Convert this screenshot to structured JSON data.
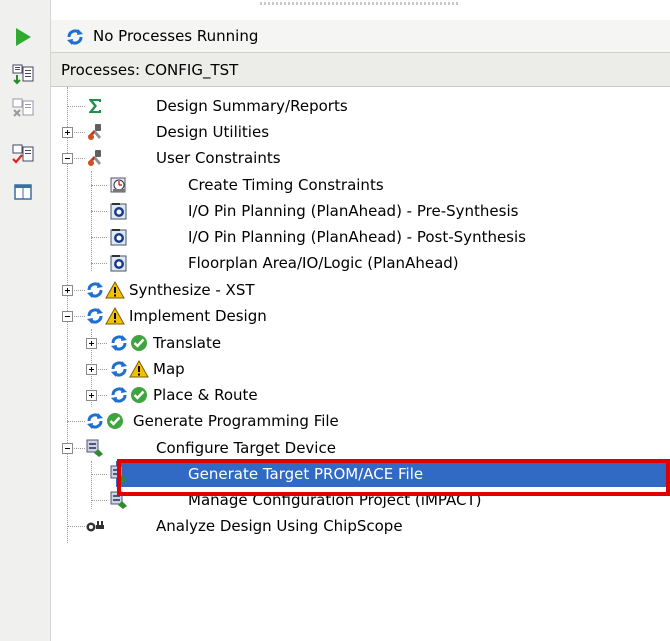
{
  "status": {
    "text": "No Processes Running",
    "icon": "refresh-icon"
  },
  "processes_header": "Processes: CONFIG_TST",
  "toolbar": [
    {
      "name": "run-icon"
    },
    {
      "name": "add-sources-icon"
    },
    {
      "name": "remove-sources-icon"
    },
    {
      "name": "check-sources-icon"
    },
    {
      "name": "window-icon"
    }
  ],
  "tree": [
    {
      "label": "Design Summary/Reports",
      "status": "none",
      "icon": "sigma-icon"
    },
    {
      "label": "Design Utilities",
      "status": "none",
      "icon": "tools-icon",
      "expanded": false
    },
    {
      "label": "User Constraints",
      "status": "none",
      "icon": "tools-icon",
      "expanded": true
    },
    {
      "label": "Create Timing Constraints",
      "status": "none",
      "icon": "clock-icon"
    },
    {
      "label": "I/O Pin Planning (PlanAhead) - Pre-Synthesis",
      "status": "none",
      "icon": "planahead-icon"
    },
    {
      "label": "I/O Pin Planning (PlanAhead) - Post-Synthesis",
      "status": "none",
      "icon": "planahead-icon"
    },
    {
      "label": "Floorplan Area/IO/Logic (PlanAhead)",
      "status": "none",
      "icon": "planahead-icon"
    },
    {
      "label": "Synthesize - XST",
      "status": "warning",
      "icon": "process-icon",
      "expanded": false
    },
    {
      "label": "Implement Design",
      "status": "warning",
      "icon": "process-icon",
      "expanded": true
    },
    {
      "label": "Translate",
      "status": "ok",
      "icon": "process-icon",
      "expanded": false
    },
    {
      "label": "Map",
      "status": "warning",
      "icon": "process-icon",
      "expanded": false
    },
    {
      "label": "Place & Route",
      "status": "ok",
      "icon": "process-icon",
      "expanded": false
    },
    {
      "label": "Generate Programming File",
      "status": "ok",
      "icon": "process-icon"
    },
    {
      "label": "Configure Target Device",
      "status": "none",
      "icon": "device-icon",
      "expanded": true
    },
    {
      "label": "Generate Target PROM/ACE File",
      "status": "none",
      "icon": "device-icon",
      "selected": true
    },
    {
      "label": "Manage Configuration Project (iMPACT)",
      "status": "none",
      "icon": "device-icon"
    },
    {
      "label": "Analyze Design Using ChipScope",
      "status": "none",
      "icon": "chipscope-icon"
    }
  ],
  "colors": {
    "selection": "#316ac5",
    "highlight_border": "#e00000",
    "ok": "#3fa33f",
    "warning": "#f2c200",
    "refresh": "#1f6fd0"
  }
}
